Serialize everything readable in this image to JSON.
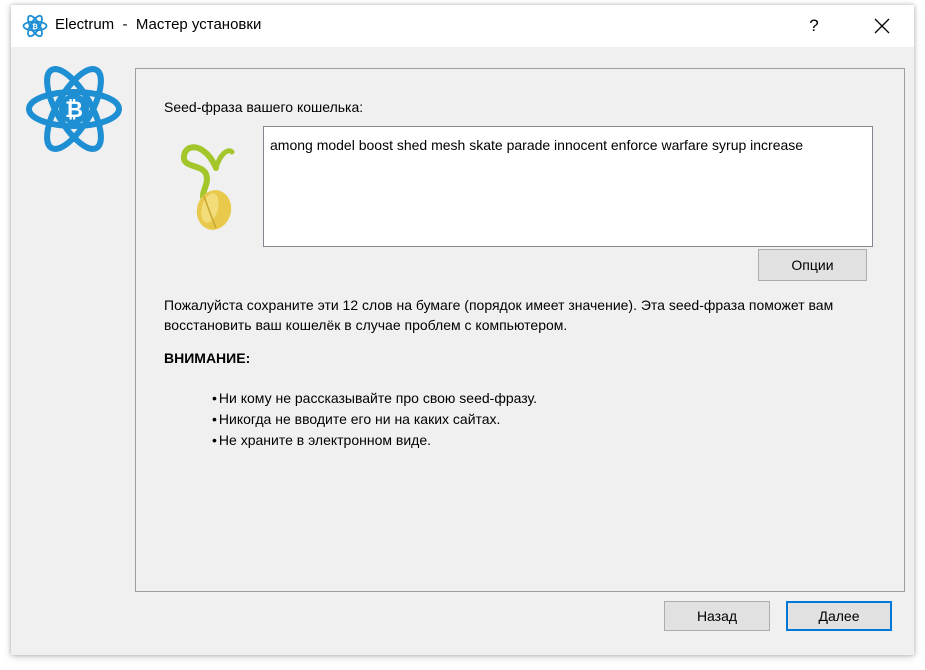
{
  "window": {
    "app_name": "Electrum",
    "separator": "-",
    "title": "Мастер установки",
    "help_label": "?"
  },
  "seed": {
    "label": "Seed-фраза вашего кошелька:",
    "phrase": "among model boost shed mesh skate parade innocent enforce warfare syrup increase",
    "options_label": "Опции"
  },
  "info": {
    "text": "Пожалуйста сохраните эти 12 слов на бумаге (порядок имеет значение). Эта seed-фраза поможет вам восстановить ваш кошелёк в случае проблем с компьютером."
  },
  "warning": {
    "title": "ВНИМАНИЕ:",
    "items": [
      "Ни кому не рассказывайте про свою seed-фразу.",
      "Никогда не вводите его ни на каких сайтах.",
      "Не храните в электронном виде."
    ]
  },
  "buttons": {
    "back": "Назад",
    "next": "Далее"
  },
  "colors": {
    "brand_blue": "#1f8fd4",
    "accent_focus": "#0078d7",
    "seed_green": "#a3c72a",
    "seed_yellow": "#e8c94b"
  },
  "icons": {
    "app": "electrum-bitcoin-atom-icon",
    "help": "help-icon",
    "close": "close-icon",
    "seed": "sprouting-seed-icon"
  }
}
